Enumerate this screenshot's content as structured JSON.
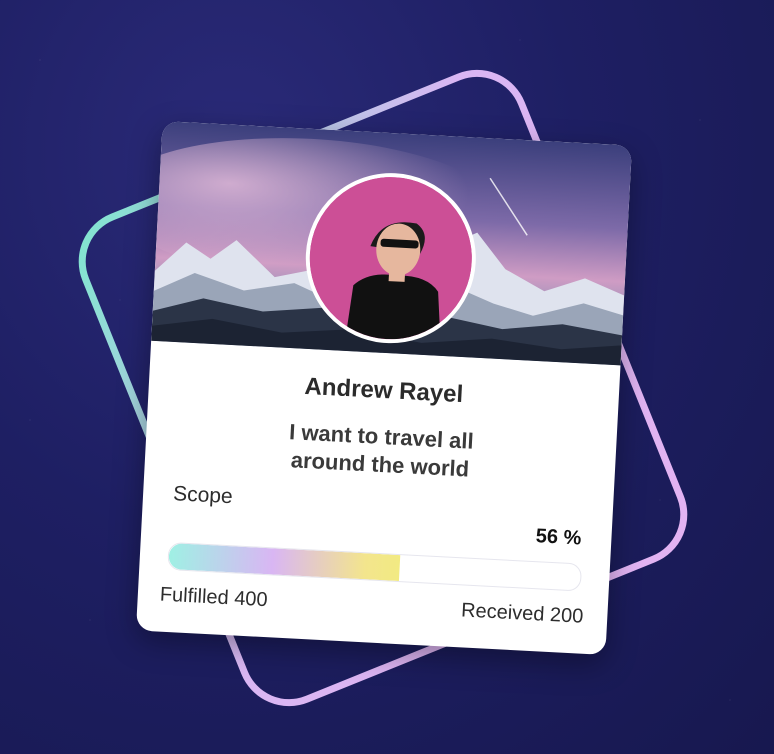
{
  "profile": {
    "name": "Andrew Rayel",
    "goal_line1": "I want to travel all",
    "goal_line2": "around the world"
  },
  "progress": {
    "label": "Scope",
    "percent_text": "56 %",
    "percent_value": 56,
    "fulfilled_text": "Fulfilled 400",
    "received_text": "Received 200"
  },
  "theme": {
    "background": "#1e1f63",
    "frame_gradient": [
      "#7fe6cf",
      "#d9b6f3",
      "#e3b3f2"
    ],
    "bar_gradient": [
      "#9ff0e4",
      "#d9b6f3",
      "#f3e58d"
    ]
  },
  "icons": {
    "avatar": "person-avatar",
    "cover": "mountain-night-sky"
  }
}
